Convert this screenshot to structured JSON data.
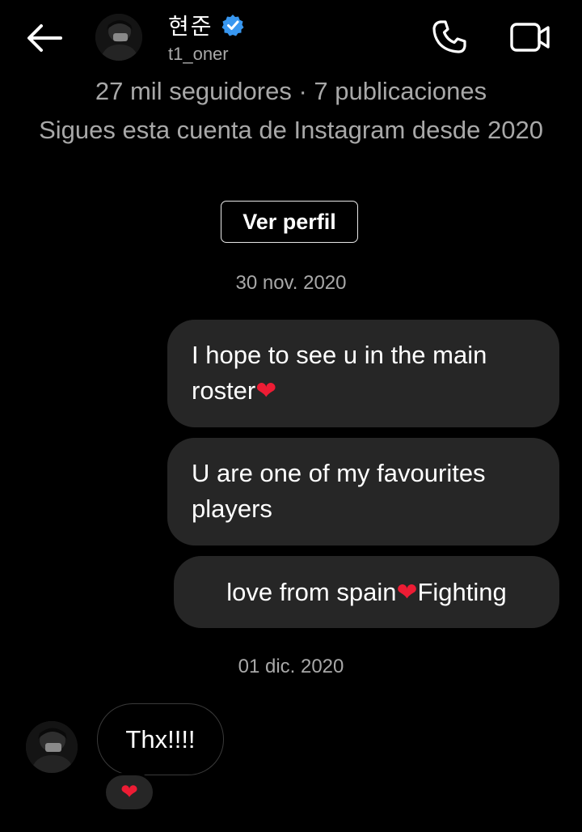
{
  "header": {
    "display_name": "현준",
    "username": "t1_oner",
    "verified": true,
    "accent_color": "#3897f0",
    "icons": {
      "back": "arrow-left-icon",
      "call": "phone-icon",
      "video": "video-camera-icon",
      "verified": "verified-badge-icon"
    }
  },
  "profile": {
    "stats": "27 mil seguidores · 7 publicaciones",
    "following_since": "Sigues esta cuenta de Instagram desde 2020",
    "view_profile_label": "Ver perfil"
  },
  "thread": {
    "date_1": "30 nov. 2020",
    "sent_messages": [
      {
        "text": "I hope to see u in the main roster",
        "emoji": "❤"
      },
      {
        "text": "U are one of my favourites players"
      },
      {
        "text_before": "love from spain",
        "emoji": "❤",
        "text_after": "Fighting"
      }
    ],
    "date_2": "01 dic. 2020",
    "received_message": {
      "text": "Thx!!!!",
      "reaction": "❤"
    }
  },
  "colors": {
    "background": "#000000",
    "bubble": "#262626",
    "secondary_text": "#a8a8a8",
    "heart": "#ed1c34"
  }
}
